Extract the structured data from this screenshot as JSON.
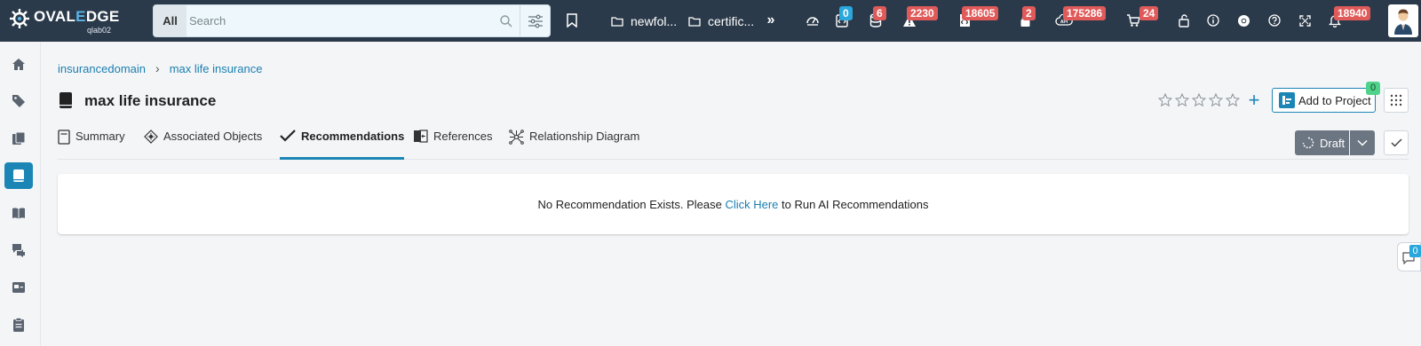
{
  "brand": {
    "name_prefix": "OVAL",
    "name_accent": "E",
    "name_suffix": "DGE",
    "subtitle": "qlab02"
  },
  "search": {
    "scope": "All",
    "placeholder": "Search"
  },
  "toolbar": {
    "folders": [
      {
        "label": "newfol..."
      },
      {
        "label": "certific..."
      }
    ],
    "badges": {
      "inbox": "0",
      "database": "6",
      "alerts": "2230",
      "code": "18605",
      "lock": "2",
      "api": "175286",
      "cart": "24",
      "notifications": "18940"
    }
  },
  "breadcrumb": {
    "domain": "insurancedomain",
    "current": "max life insurance"
  },
  "page": {
    "title": "max life insurance"
  },
  "actions": {
    "add_to_project": "Add to Project",
    "project_count": "0",
    "status": "Draft"
  },
  "tabs": [
    {
      "label": "Summary"
    },
    {
      "label": "Associated Objects"
    },
    {
      "label": "Recommendations"
    },
    {
      "label": "References"
    },
    {
      "label": "Relationship Diagram"
    }
  ],
  "recommendations": {
    "message_before": "No Recommendation Exists. Please ",
    "link": "Click Here",
    "message_after": " to Run AI Recommendations"
  },
  "comments": {
    "count": "0"
  },
  "colors": {
    "topbar": "#2b3a4a",
    "accent": "#1b86b5",
    "badge_red": "#e05a5a",
    "badge_blue": "#2aa7dc"
  }
}
